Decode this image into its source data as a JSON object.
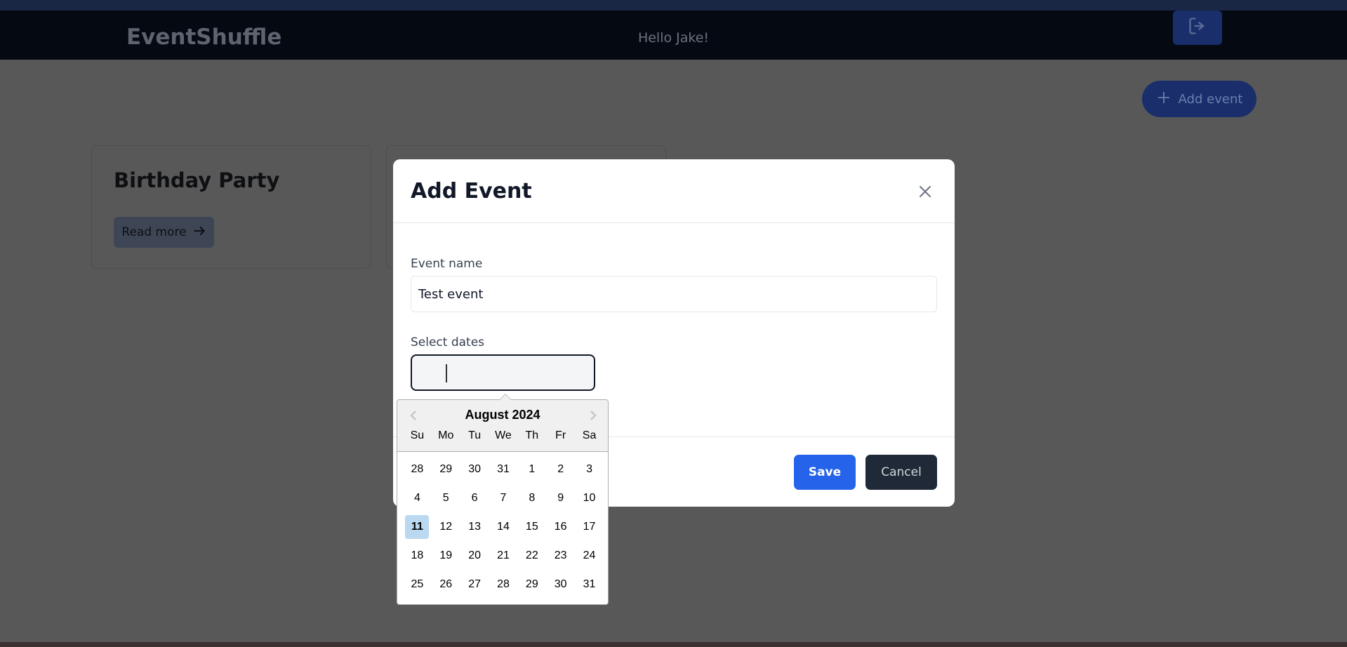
{
  "nav": {
    "brand": "EventShuffle",
    "greeting": "Hello Jake!"
  },
  "toolbar": {
    "add_event_label": "Add event"
  },
  "cards": [
    {
      "title": "Birthday Party",
      "read_more_label": "Read more"
    }
  ],
  "modal": {
    "title": "Add Event",
    "event_name_label": "Event name",
    "event_name_value": "Test event",
    "dates_label": "Select dates",
    "save_label": "Save",
    "cancel_label": "Cancel"
  },
  "datepicker": {
    "month_label": "August 2024",
    "weekdays": [
      "Su",
      "Mo",
      "Tu",
      "We",
      "Th",
      "Fr",
      "Sa"
    ],
    "weeks": [
      [
        "28",
        "29",
        "30",
        "31",
        "1",
        "2",
        "3"
      ],
      [
        "4",
        "5",
        "6",
        "7",
        "8",
        "9",
        "10"
      ],
      [
        "11",
        "12",
        "13",
        "14",
        "15",
        "16",
        "17"
      ],
      [
        "18",
        "19",
        "20",
        "21",
        "22",
        "23",
        "24"
      ],
      [
        "25",
        "26",
        "27",
        "28",
        "29",
        "30",
        "31"
      ]
    ],
    "highlighted_day": "11"
  },
  "colors": {
    "primary": "#2563eb",
    "navbar": "#050912",
    "overlay": "#585858",
    "today_highlight": "#bad9f1"
  },
  "icons": {
    "logout": "logout-icon",
    "add": "plus-icon",
    "arrow": "arrow-right-icon",
    "close": "close-icon",
    "prev": "chevron-left-icon",
    "next": "chevron-right-icon"
  }
}
